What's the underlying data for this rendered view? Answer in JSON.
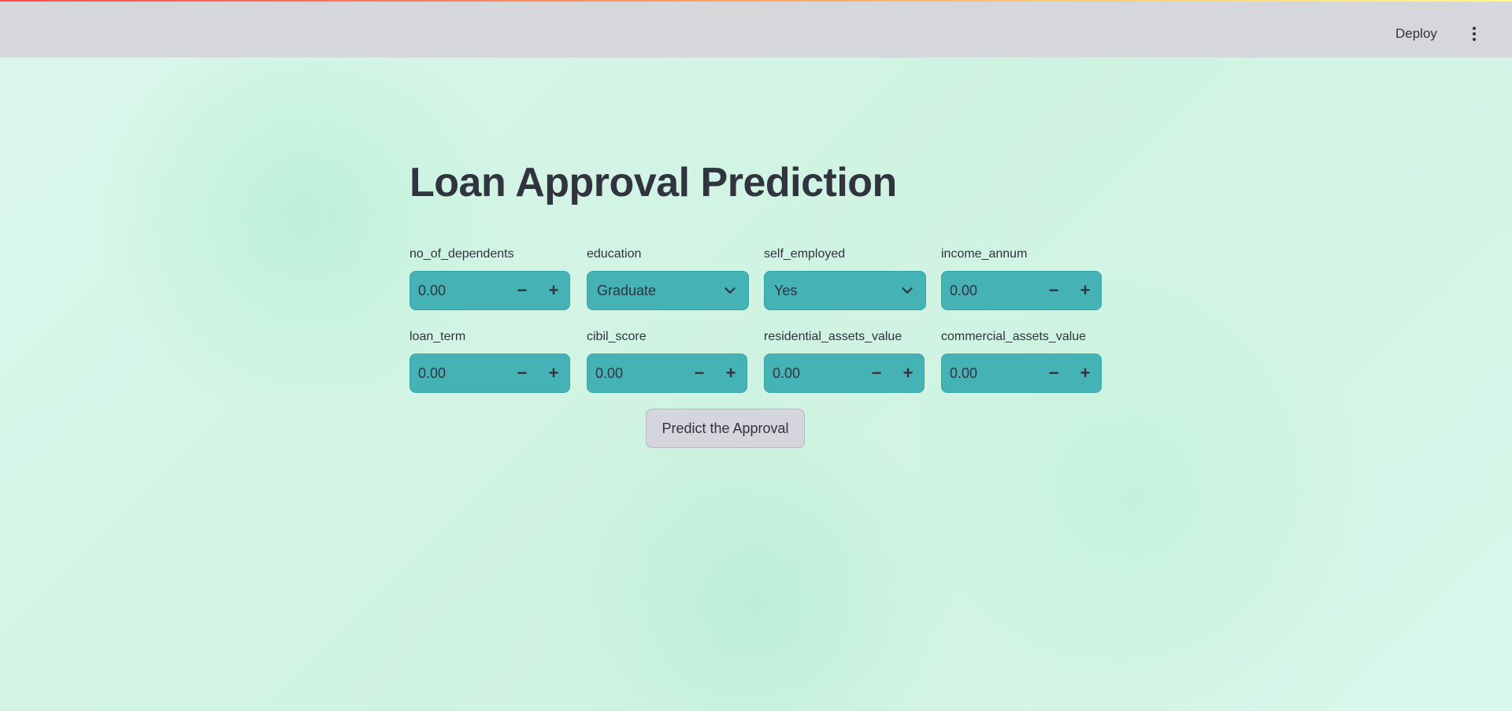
{
  "header": {
    "deploy_label": "Deploy",
    "menu_icon": "kebab-menu-icon"
  },
  "main": {
    "title": "Loan Approval Prediction",
    "fields": [
      {
        "label": "no_of_dependents",
        "type": "number",
        "value": "0.00"
      },
      {
        "label": "education",
        "type": "select",
        "value": "Graduate"
      },
      {
        "label": "self_employed",
        "type": "select",
        "value": "Yes"
      },
      {
        "label": "income_annum",
        "type": "number",
        "value": "0.00"
      },
      {
        "label": "loan_term",
        "type": "number",
        "value": "0.00"
      },
      {
        "label": "cibil_score",
        "type": "number",
        "value": "0.00"
      },
      {
        "label": "residential_assets_value",
        "type": "number",
        "value": "0.00"
      },
      {
        "label": "commercial_assets_value",
        "type": "number",
        "value": "0.00"
      }
    ],
    "stepper": {
      "minus": "−",
      "plus": "+"
    },
    "predict_label": "Predict the Approval"
  },
  "colors": {
    "input_bg": "#45b3b6",
    "header_bg": "#d6d7db",
    "page_bg": "#d6f5e8",
    "text": "#31333f"
  }
}
